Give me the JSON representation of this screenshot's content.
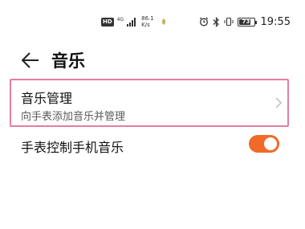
{
  "status_bar": {
    "hd_label": "HD",
    "network_type": "4G",
    "net_speed_value": "86.1",
    "net_speed_unit": "K/s",
    "battery_level": "73",
    "time": "19:55",
    "icons": [
      "signal-icon",
      "leaf-icon",
      "alarm-icon",
      "bluetooth-icon",
      "vibrate-icon",
      "battery-icon"
    ]
  },
  "header": {
    "title": "音乐",
    "back_icon": "arrow-left-icon"
  },
  "settings": {
    "music_management": {
      "title": "音乐管理",
      "subtitle": "向手表添加音乐并管理",
      "accent_border_color": "#e57da1"
    },
    "phone_music_control": {
      "label": "手表控制手机音乐",
      "enabled": true,
      "toggle_color": "#f06a28"
    }
  }
}
